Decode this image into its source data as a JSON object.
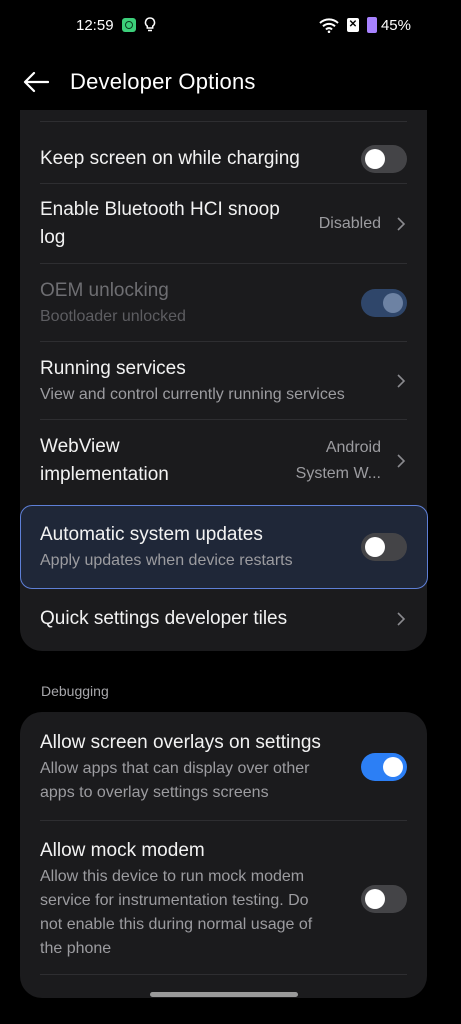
{
  "status_bar": {
    "time": "12:59",
    "battery": "45%",
    "icons": [
      "app-badge-icon",
      "lightbulb-icon",
      "wifi-icon",
      "sim-blocked-icon",
      "battery-charging-icon"
    ]
  },
  "header": {
    "title": "Developer Options",
    "back_icon": "arrow-left-icon"
  },
  "colors": {
    "background": "#000000",
    "card": "#1b1b1d",
    "accent": "#2c7ff5",
    "highlight_border": "#5e7fd6"
  },
  "card1": {
    "items": [
      {
        "title": "Keep screen on while charging",
        "control": "toggle",
        "state": false
      },
      {
        "title": "Enable Bluetooth HCI snoop",
        "title2": "log",
        "value": "Disabled",
        "control": "chevron"
      },
      {
        "title": "OEM unlocking",
        "subtitle": "Bootloader unlocked",
        "control": "toggle",
        "state": true,
        "disabled": true
      },
      {
        "title": "Running services",
        "subtitle": "View and control currently running services",
        "control": "chevron"
      },
      {
        "title": "WebView",
        "title2": "implementation",
        "value": "Android",
        "value2": "System W...",
        "control": "chevron"
      },
      {
        "title": "Automatic system updates",
        "subtitle": "Apply updates when device restarts",
        "control": "toggle",
        "state": false,
        "highlighted": true
      },
      {
        "title": "Quick settings developer tiles",
        "control": "chevron"
      }
    ]
  },
  "debugging": {
    "header": "Debugging",
    "items": [
      {
        "title": "Allow screen overlays on settings",
        "subtitle": "Allow apps that can display over other",
        "subtitle2": "apps to overlay settings screens",
        "control": "toggle",
        "state": true
      },
      {
        "title": "Allow mock modem",
        "subtitle": "Allow this device to run mock modem",
        "subtitle2": "service for instrumentation testing. Do",
        "subtitle3": "not enable this during normal usage of",
        "subtitle4": "the phone",
        "control": "toggle",
        "state": false
      }
    ]
  }
}
